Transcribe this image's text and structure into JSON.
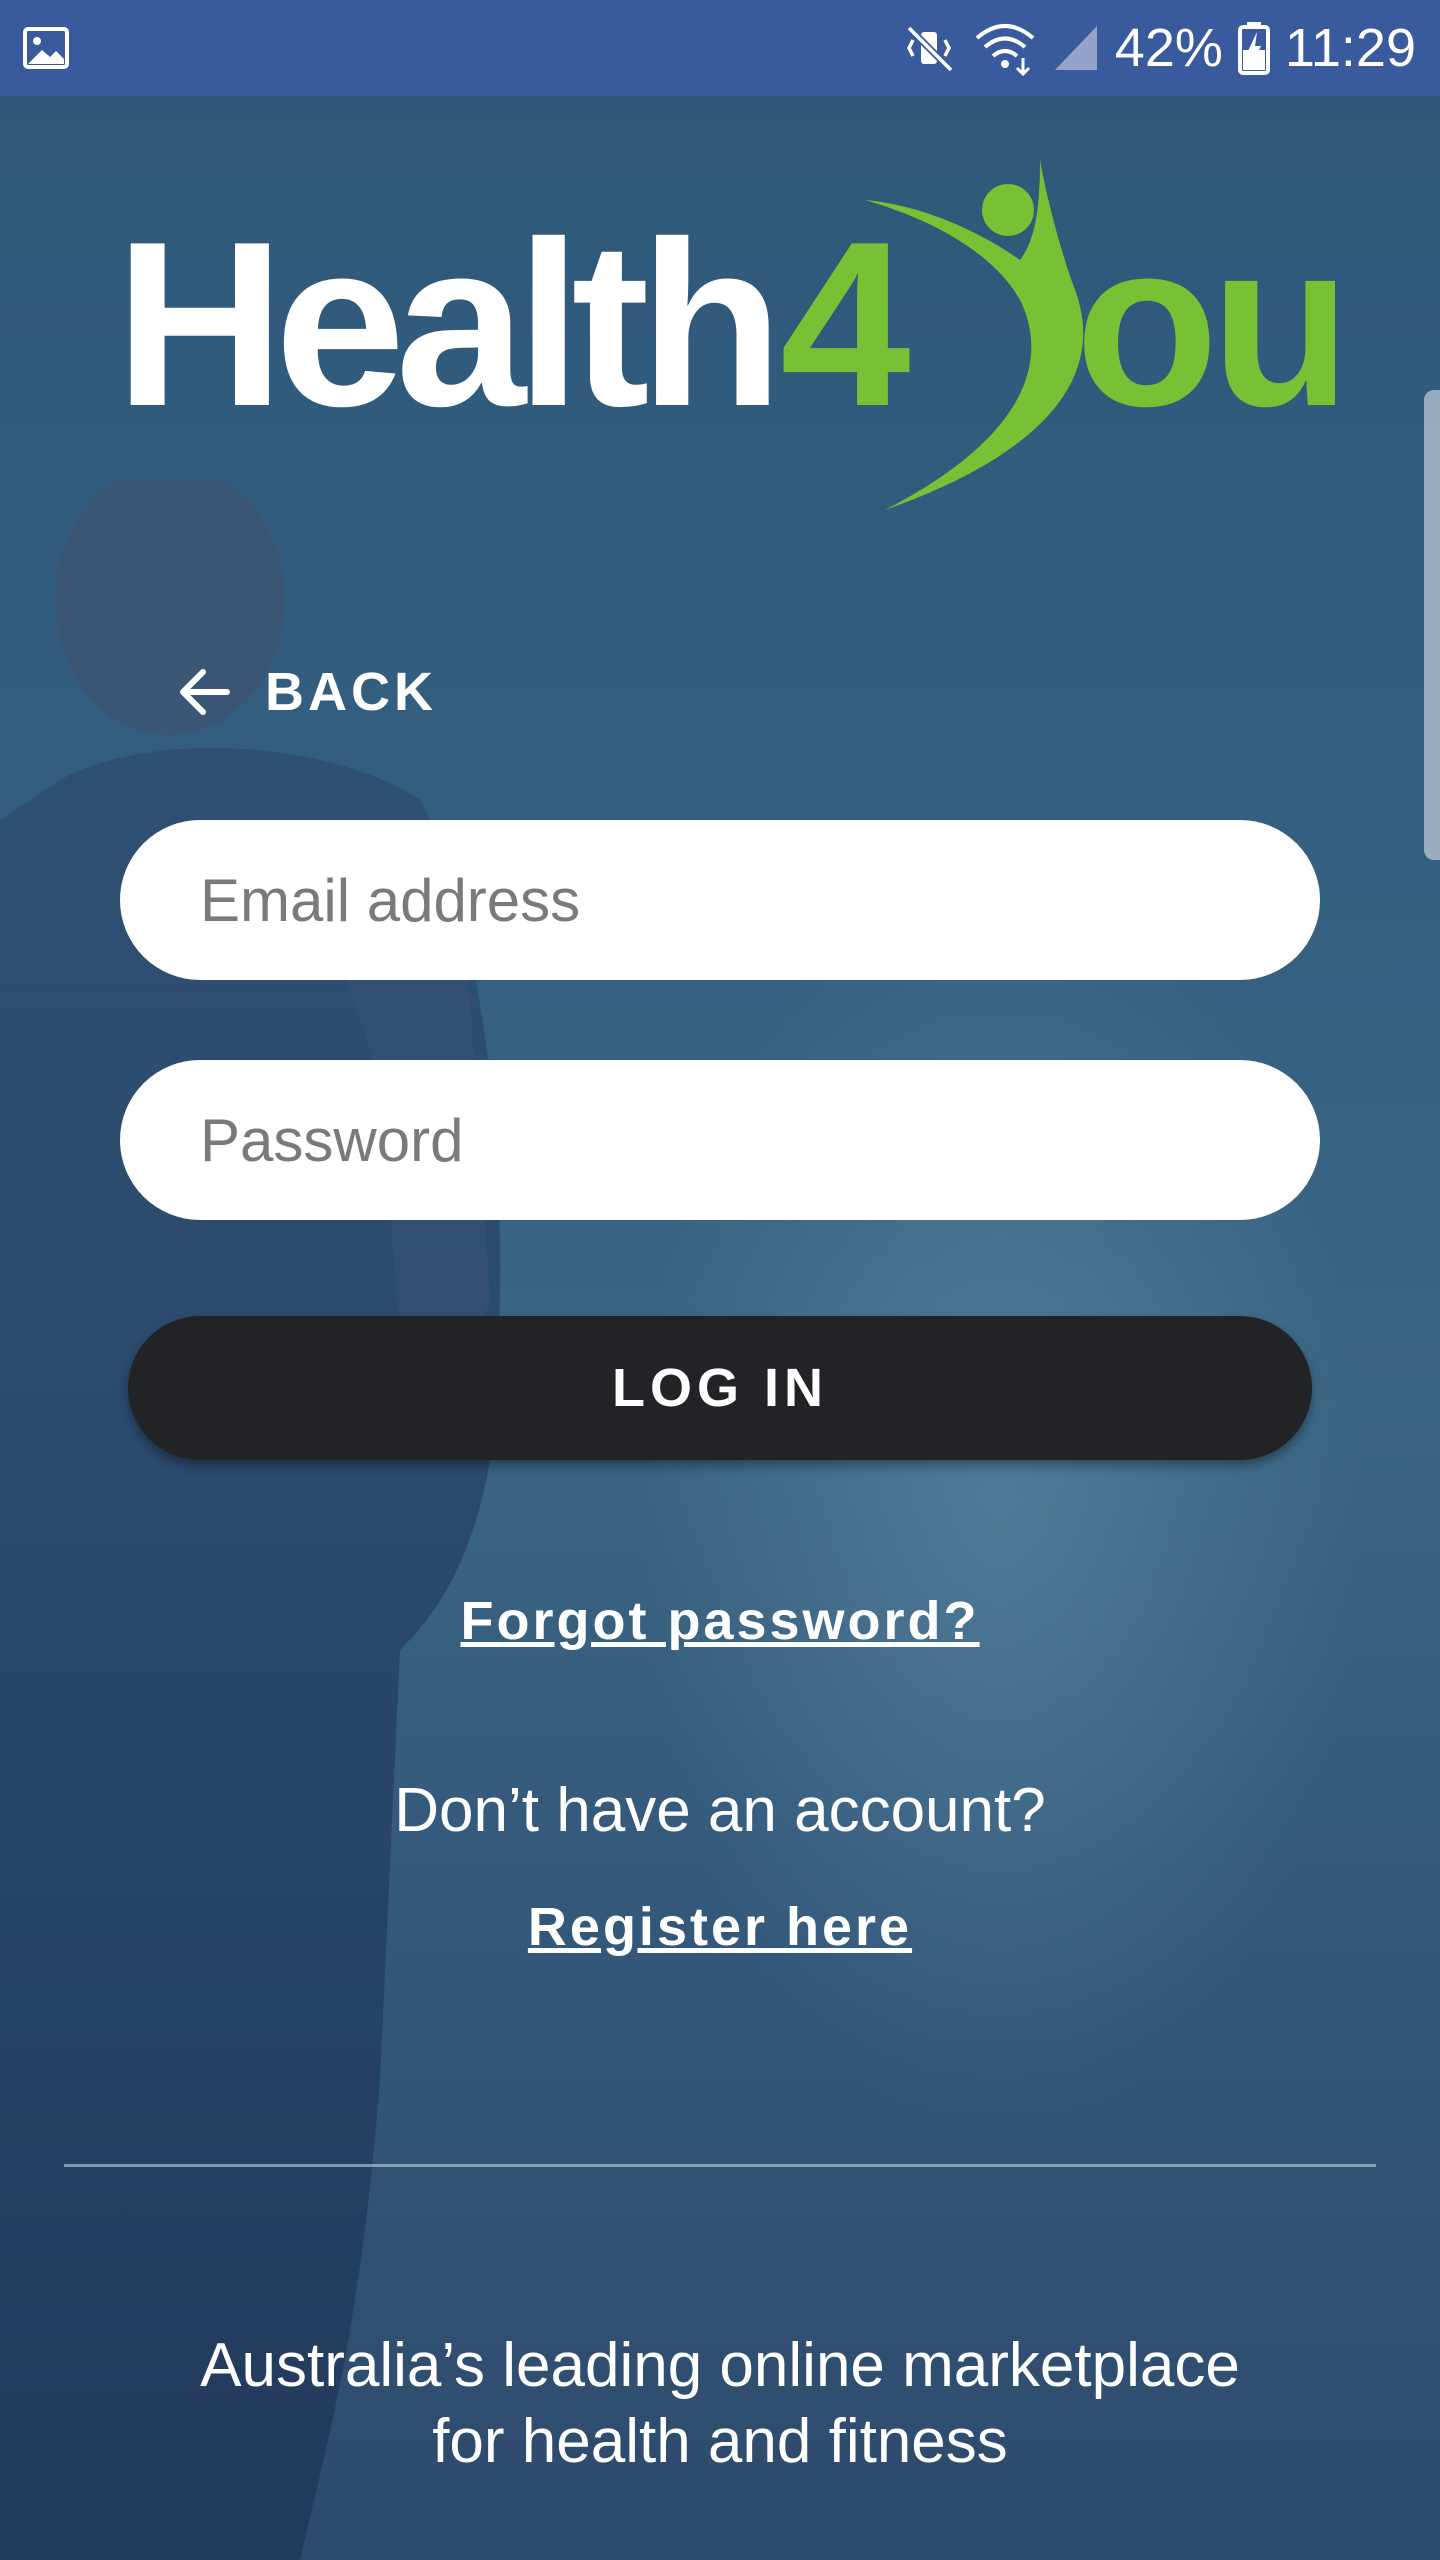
{
  "colors": {
    "statusbar": "#3a5a9e",
    "brand_white": "#ffffff",
    "brand_green": "#76c234",
    "login_button": "#222327"
  },
  "status_bar": {
    "battery": "42%",
    "time": "11:29",
    "icons": [
      "image-icon",
      "mute-vibrate-icon",
      "wifi-icon",
      "signal-icon",
      "battery-charging-icon"
    ]
  },
  "logo": {
    "word_white": "Health",
    "word_green_4": "4",
    "word_green_ou": "ou"
  },
  "back": {
    "label": "BACK",
    "icon": "arrow-left-icon"
  },
  "form": {
    "email_placeholder": "Email address",
    "email_value": "",
    "password_placeholder": "Password",
    "password_value": "",
    "login_label": "LOG IN"
  },
  "links": {
    "forgot_password": "Forgot password?",
    "no_account": "Don’t have an account?",
    "register": "Register here"
  },
  "footer": {
    "tagline_line1": "Australia’s leading online marketplace",
    "tagline_line2": "for health and fitness"
  }
}
